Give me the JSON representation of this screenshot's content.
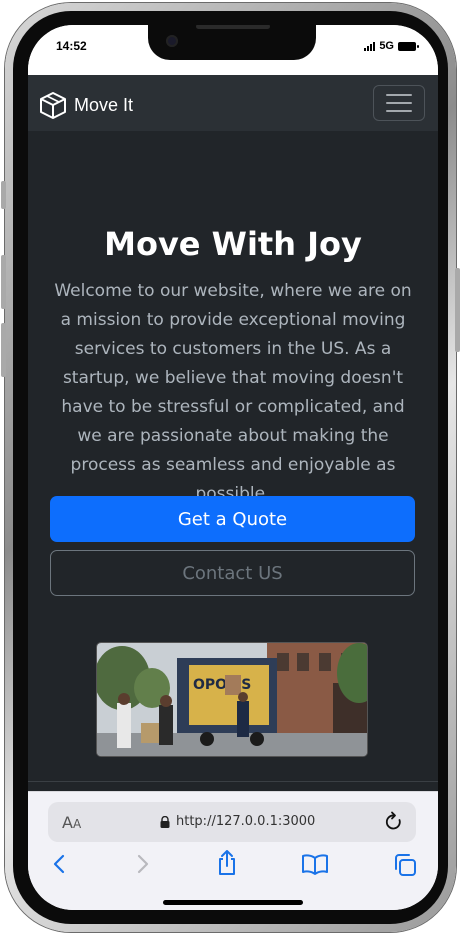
{
  "status": {
    "time": "14:52",
    "network": "5G"
  },
  "navbar": {
    "brand": "Move It"
  },
  "hero": {
    "title": "Move With Joy",
    "text": "Welcome to our website, where we are on a mission to provide exceptional moving services to customers in the US. As a startup, we believe that moving doesn't have to be stressful or complicated, and we are passionate about making the process as seamless and enjoyable as possible.",
    "primary_button": "Get a Quote",
    "secondary_button": "Contact US",
    "truck_text": "OPOLIS"
  },
  "browser": {
    "text_size_label": "AA",
    "url": "http://127.0.0.1:3000"
  },
  "colors": {
    "primary": "#0d6efd",
    "background": "#212529",
    "navbar": "#2b3035"
  }
}
